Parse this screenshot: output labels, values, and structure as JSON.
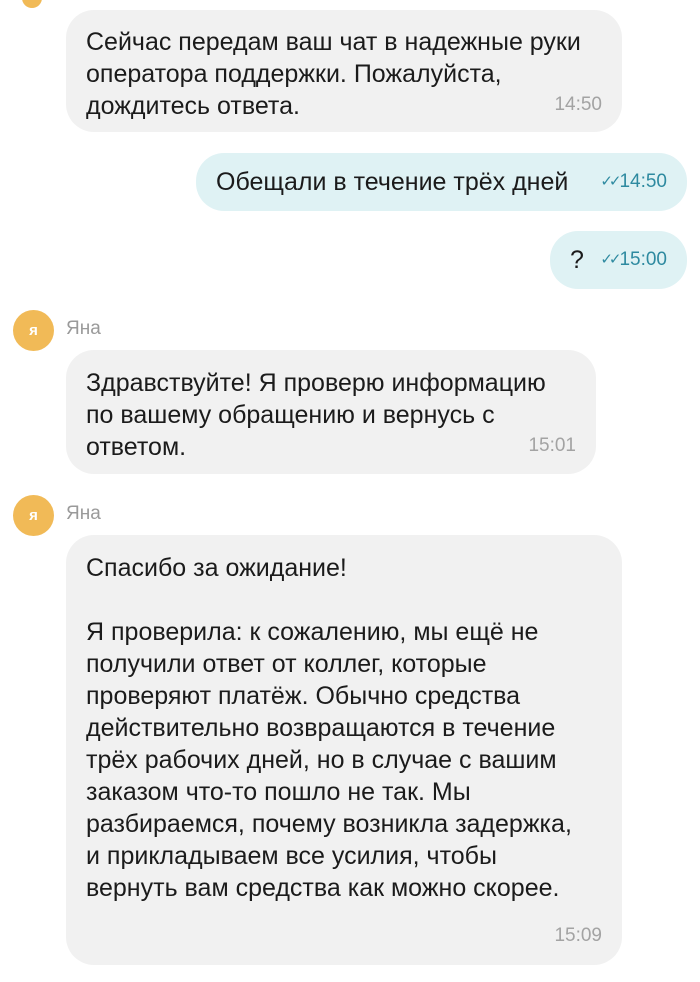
{
  "messages": [
    {
      "text": "Сейчас передам ваш чат в надежные руки\nоператора поддержки. Пожалуйста,\nдождитесь ответа.",
      "time": "14:50"
    },
    {
      "text": "Обещали в течение трёх дней",
      "time": "14:50"
    },
    {
      "text": "?",
      "time": "15:00"
    },
    {
      "avatar_letter": "я",
      "sender": "Яна",
      "text": "Здравствуйте! Я проверю информацию\nпо вашему обращению и вернусь с\nответом.",
      "time": "15:01"
    },
    {
      "avatar_letter": "я",
      "sender": "Яна",
      "text": "Спасибо за ожидание!\n\nЯ проверила: к сожалению, мы ещё не\nполучили ответ от коллег, которые\nпроверяют платёж. Обычно средства\nдействительно возвращаются в течение\nтрёх рабочих дней, но в случае с вашим\nзаказом что-то пошло не так. Мы\nразбираемся, почему возникла задержка,\nи прикладываем все усилия, чтобы\nвернуть вам средства как можно скорее.",
      "time": "15:09"
    }
  ],
  "read_status_icon": "double-check-icon",
  "colors": {
    "incoming_bubble": "#f1f1f1",
    "outgoing_bubble": "#dff2f4",
    "avatar": "#f1ba57",
    "outgoing_time": "#2e8aa0"
  }
}
